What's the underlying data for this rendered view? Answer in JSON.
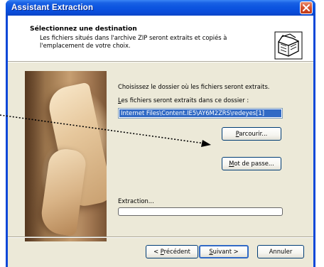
{
  "window": {
    "title": "Assistant Extraction"
  },
  "header": {
    "title": "Sélectionnez une destination",
    "description": "Les fichiers situés dans l'archive ZIP seront extraits et copiés à l'emplacement de votre choix."
  },
  "form": {
    "choose_text": "Choisissez le dossier où les fichiers seront extraits.",
    "dest_label_prefix": "",
    "dest_label_mnemonic": "L",
    "dest_label_rest": "es fichiers seront extraits dans ce dossier :",
    "path_value": "Internet Files\\Content.IE5\\AY6M2ZRS\\redeyes[1]",
    "browse_pre": "",
    "browse_mnemonic": "P",
    "browse_post": "arcourir...",
    "password_pre": "",
    "password_mnemonic": "M",
    "password_post": "ot de passe...",
    "extraction_label": "Extraction...",
    "extraction_progress": 0
  },
  "footer": {
    "prev_pre": "< ",
    "prev_mnemonic": "P",
    "prev_post": "récédent",
    "next_pre": "",
    "next_mnemonic": "S",
    "next_post": "uivant >",
    "cancel_label": "Annuler"
  },
  "icons": {
    "close": "close-icon",
    "zip": "zip-folder-icon",
    "picture": "extraction-wizard-picture"
  },
  "colors": {
    "titlebar": "#0a4ddb",
    "client": "#ece9d8",
    "selection": "#316ac5",
    "close": "#d6502c"
  }
}
